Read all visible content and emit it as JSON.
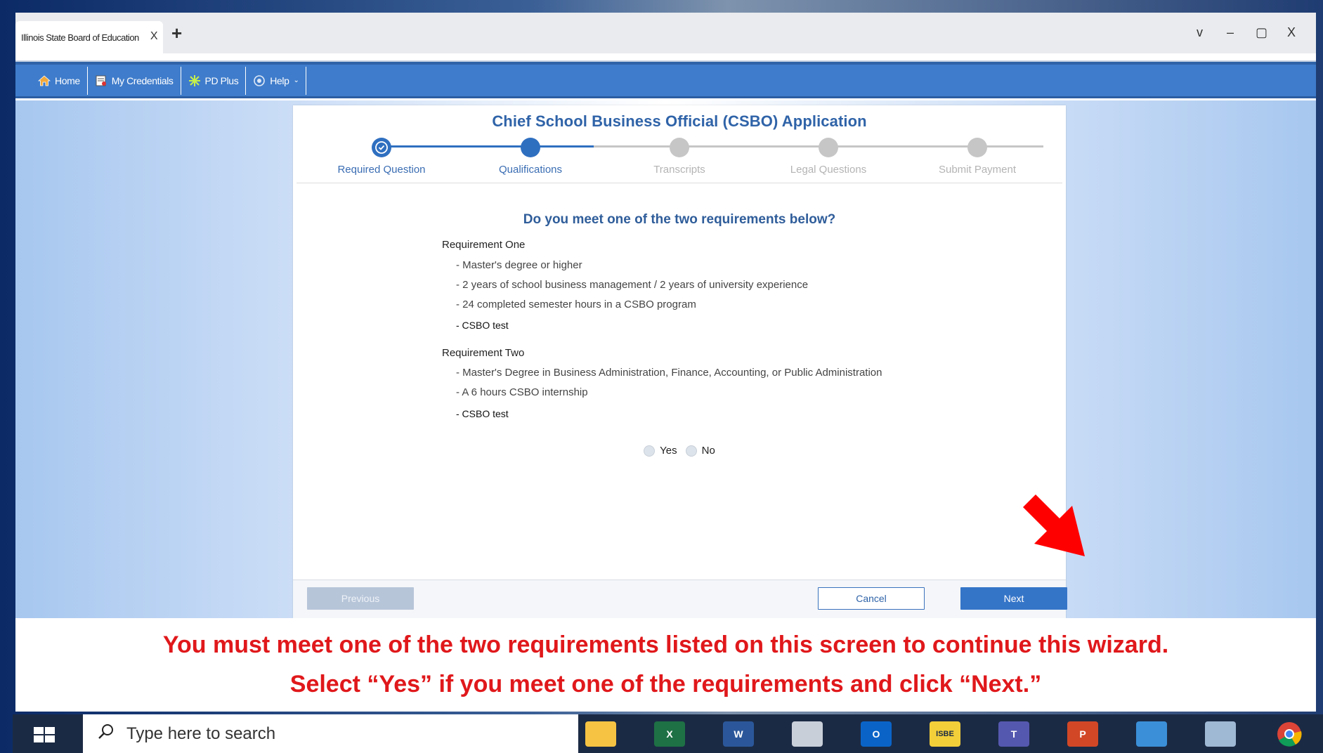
{
  "browser": {
    "tab_title": "Illinois State Board of Education",
    "tab_close": "X",
    "new_tab": "+",
    "controls": {
      "chevron": "v",
      "minimize": "–",
      "restore": "▢",
      "close": "X"
    }
  },
  "nav": {
    "items": [
      {
        "label": "Home",
        "icon": "home-icon"
      },
      {
        "label": "My Credentials",
        "icon": "credentials-icon"
      },
      {
        "label": "PD Plus",
        "icon": "star-icon"
      },
      {
        "label": "Help",
        "icon": "help-icon"
      }
    ]
  },
  "app": {
    "title": "Chief School Business Official (CSBO) Application",
    "steps": [
      {
        "label": "Required Question",
        "state": "complete"
      },
      {
        "label": "Qualifications",
        "state": "current"
      },
      {
        "label": "Transcripts",
        "state": "pending"
      },
      {
        "label": "Legal Questions",
        "state": "pending"
      },
      {
        "label": "Submit Payment",
        "state": "pending"
      }
    ],
    "question": "Do you meet one of the two requirements below?",
    "req1": {
      "heading": "Requirement One",
      "items": [
        "- Master's degree or higher",
        "- 2 years of school business management / 2 years of university experience",
        "- 24 completed semester hours in a CSBO program",
        "- CSBO test"
      ]
    },
    "req2": {
      "heading": "Requirement Two",
      "items": [
        "- Master's Degree in Business Administration, Finance, Accounting, or Public Administration",
        "- A 6 hours CSBO internship",
        "- CSBO test"
      ]
    },
    "options": {
      "yes": "Yes",
      "no": "No"
    },
    "buttons": {
      "previous": "Previous",
      "cancel": "Cancel",
      "next": "Next"
    }
  },
  "instructions": {
    "line1": "You must meet one of the two requirements listed on this screen to continue this wizard.",
    "line2": "Select “Yes” if you meet one of the requirements and click “Next.”"
  },
  "taskbar": {
    "search_placeholder": "Type here to search",
    "apps": [
      "file-explorer",
      "excel",
      "word",
      "snipping-tool",
      "outlook",
      "isbe",
      "teams",
      "powerpoint",
      "remote-desktop",
      "calculator",
      "chrome"
    ],
    "app_letters": {
      "excel": "X",
      "word": "W",
      "outlook": "O",
      "isbe": "ISBE",
      "teams": "T",
      "powerpoint": "P"
    }
  },
  "colors": {
    "accent": "#3f7ccb",
    "step_active": "#2f6fc0",
    "step_pending": "#c6c6c6",
    "instruction_red": "#e0181b"
  }
}
